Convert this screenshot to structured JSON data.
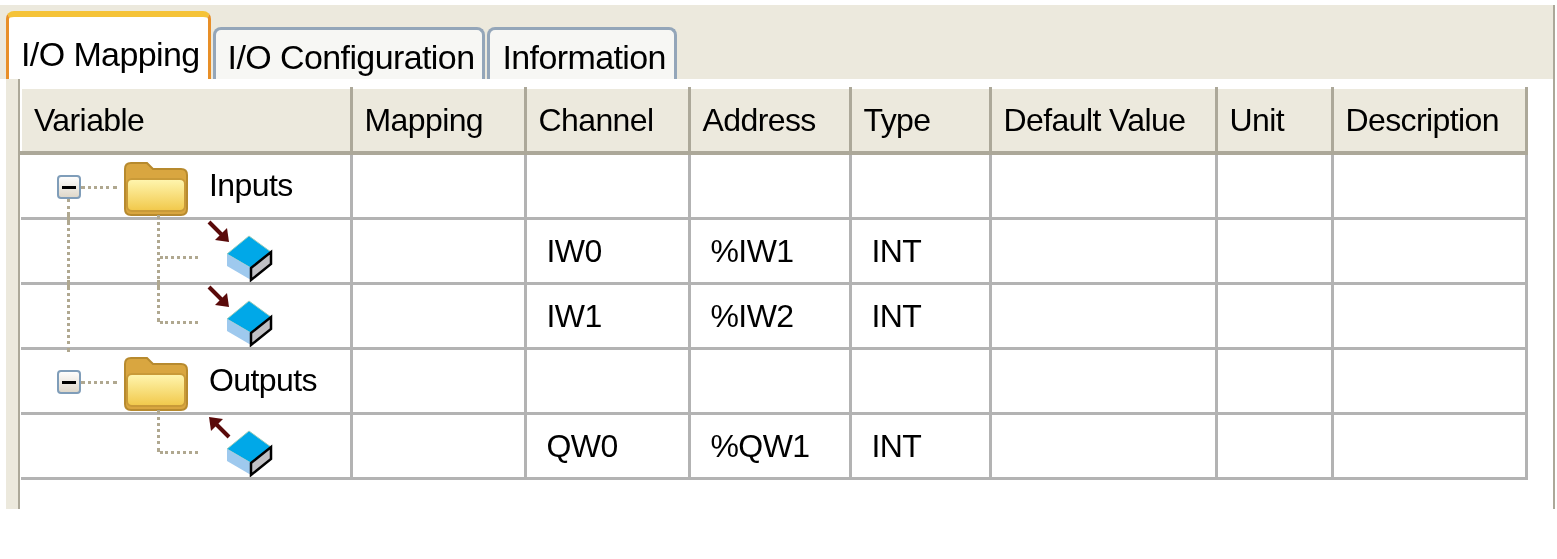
{
  "tabs": [
    {
      "label": "I/O Mapping",
      "selected": true
    },
    {
      "label": "I/O Configuration",
      "selected": false
    },
    {
      "label": "Information",
      "selected": false
    }
  ],
  "table": {
    "columns": [
      "Variable",
      "Mapping",
      "Channel",
      "Address",
      "Type",
      "Default Value",
      "Unit",
      "Description"
    ],
    "rows": [
      {
        "kind": "folder",
        "name": "Inputs",
        "expanded": true,
        "children": [
          {
            "kind": "input",
            "channel": "IW0",
            "address": "%IW1",
            "type": "INT"
          },
          {
            "kind": "input",
            "channel": "IW1",
            "address": "%IW2",
            "type": "INT"
          }
        ]
      },
      {
        "kind": "folder",
        "name": "Outputs",
        "expanded": true,
        "children": [
          {
            "kind": "output",
            "channel": "QW0",
            "address": "%QW1",
            "type": "INT"
          }
        ]
      }
    ]
  }
}
